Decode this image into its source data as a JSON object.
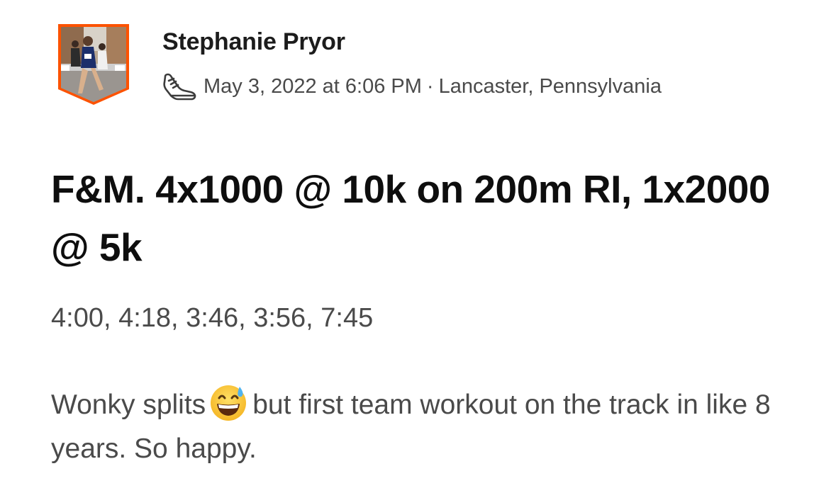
{
  "athlete": {
    "name": "Stephanie Pryor",
    "avatar_icon": "runner-photo-avatar"
  },
  "activity": {
    "sport_icon": "running-shoe-icon",
    "date_time": "May 3, 2022 at 6:06 PM",
    "separator": "·",
    "location": "Lancaster, Pennsylvania",
    "title": "F&M. 4x1000 @ 10k on 200m RI, 1x2000 @ 5k",
    "splits": "4:00, 4:18, 3:46, 3:56, 7:45",
    "description": {
      "before_emoji": "Wonky splits",
      "emoji": "grinning-face-with-sweat",
      "after_emoji": "but first team workout on the track in like 8 years. So happy."
    }
  },
  "colors": {
    "avatar_border": "#fc5200",
    "title_text": "#0e0e0e",
    "body_text": "#4a4a4a"
  }
}
